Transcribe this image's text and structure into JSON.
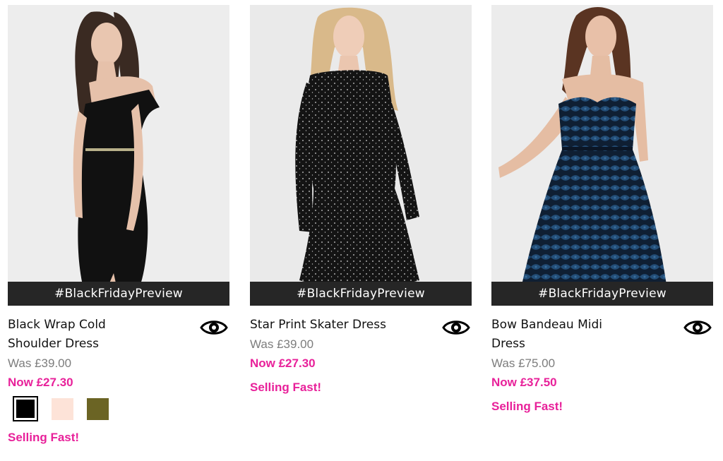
{
  "products": [
    {
      "name": "Black Wrap Cold Shoulder Dress",
      "image_label": "#BlackFridayPreview",
      "was_price": "Was £39.00",
      "now_price": "Now £27.30",
      "status": "Selling Fast!",
      "swatches": [
        {
          "name": "black",
          "color": "#000000",
          "selected": true
        },
        {
          "name": "blush",
          "color": "#fde3d8",
          "selected": false
        },
        {
          "name": "khaki",
          "color": "#6b6424",
          "selected": false
        }
      ]
    },
    {
      "name": "Star Print Skater Dress",
      "image_label": "#BlackFridayPreview",
      "was_price": "Was £39.00",
      "now_price": "Now £27.30",
      "status": "Selling Fast!"
    },
    {
      "name": "Bow Bandeau Midi Dress",
      "image_label": "#BlackFridayPreview",
      "was_price": "Was £75.00",
      "now_price": "Now £37.50",
      "status": "Selling Fast!"
    }
  ],
  "icons": {
    "quick_view": "eye-icon"
  },
  "colors": {
    "sale_pink": "#e8219a",
    "was_grey": "#7d7d7d",
    "banner_dark": "#262626"
  }
}
